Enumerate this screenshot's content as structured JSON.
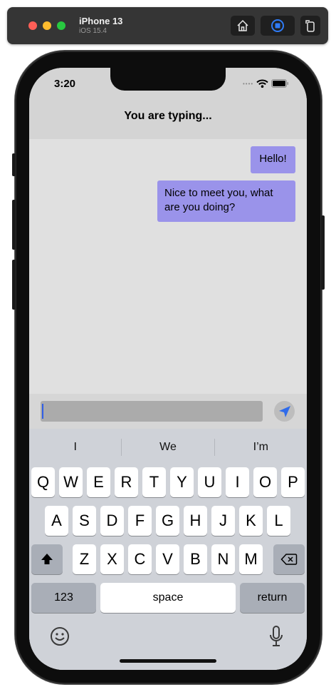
{
  "simulator": {
    "device_name": "iPhone 13",
    "os_version": "iOS 15.4"
  },
  "status_bar": {
    "time": "3:20"
  },
  "nav": {
    "title": "You are typing..."
  },
  "messages": [
    {
      "text": "Hello!"
    },
    {
      "text": "Nice to meet you, what are you doing?"
    }
  ],
  "input": {
    "value": "",
    "placeholder": ""
  },
  "suggestions": [
    "I",
    "We",
    "I’m"
  ],
  "keyboard": {
    "row1": [
      "Q",
      "W",
      "E",
      "R",
      "T",
      "Y",
      "U",
      "I",
      "O",
      "P"
    ],
    "row2": [
      "A",
      "S",
      "D",
      "F",
      "G",
      "H",
      "J",
      "K",
      "L"
    ],
    "row3": [
      "Z",
      "X",
      "C",
      "V",
      "B",
      "N",
      "M"
    ],
    "numbers_label": "123",
    "space_label": "space",
    "return_label": "return"
  },
  "colors": {
    "bubble": "#9a93ea",
    "nav_background": "#d4d4d4",
    "chat_background": "#e0e0e0",
    "keyboard_background": "#cfd2d8",
    "send_icon": "#2f6bea"
  },
  "icons": [
    "home-icon",
    "screenshot-icon",
    "rotate-icon",
    "wifi-icon",
    "battery-icon",
    "send-icon",
    "shift-icon",
    "backspace-icon",
    "emoji-icon",
    "microphone-icon"
  ]
}
